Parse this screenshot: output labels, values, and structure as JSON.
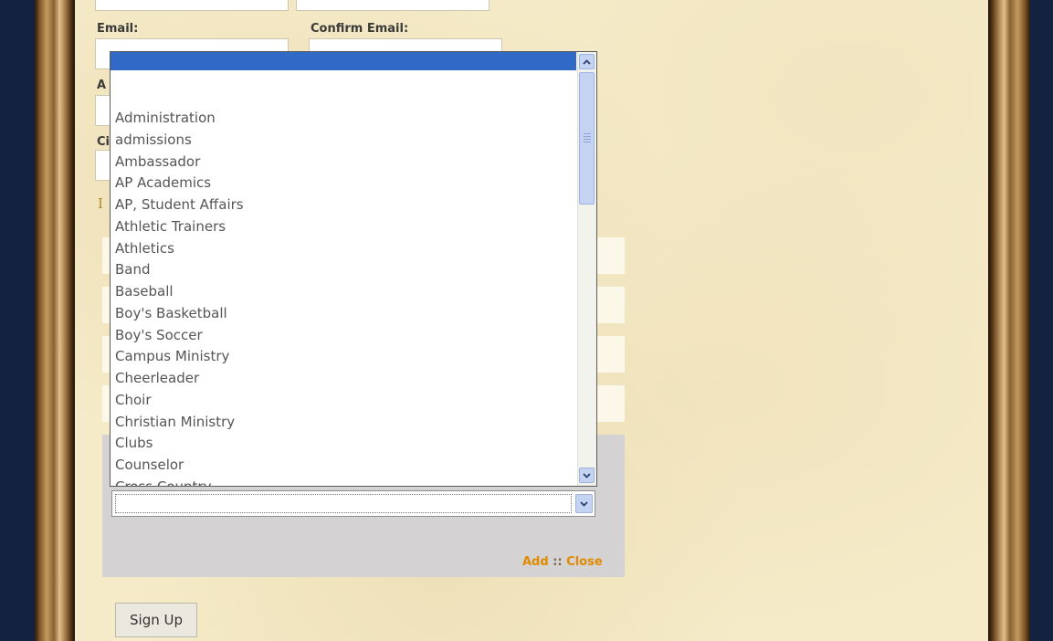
{
  "form": {
    "email_label": "Email:",
    "confirm_email_label": "Confirm Email:",
    "partial_labels": [
      "A",
      "Ci"
    ],
    "partial_text": "I",
    "signup_button": "Sign Up"
  },
  "panel": {
    "add_link": "Add",
    "separator": "::",
    "close_link": "Close"
  },
  "dropdown": {
    "selected": "",
    "options": [
      "Administration",
      "admissions",
      "Ambassador",
      "AP Academics",
      "AP, Student Affairs",
      "Athletic Trainers",
      "Athletics",
      "Band",
      "Baseball",
      "Boy's Basketball",
      "Boy's Soccer",
      "Campus Ministry",
      "Cheerleader",
      "Choir",
      "Christian Ministry",
      "Clubs",
      "Counselor",
      "Cross Country"
    ]
  },
  "icons": {
    "scroll_up": "chevron-up-icon",
    "scroll_down": "chevron-down-icon",
    "select_arrow": "chevron-down-icon"
  },
  "colors": {
    "highlight": "#3169c6",
    "link": "#e08a00",
    "panel": "#d4d2d2",
    "background": "#13233f"
  }
}
